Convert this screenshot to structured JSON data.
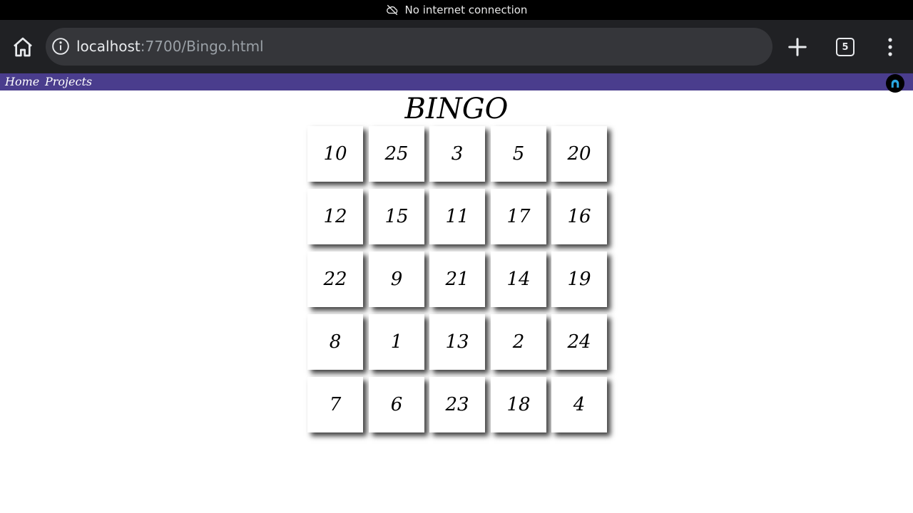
{
  "status": {
    "text": "No internet connection",
    "icon": "cloud-off-icon"
  },
  "browser": {
    "url_host": "localhost",
    "url_path": ":7700/Bingo.html",
    "tab_count": "5",
    "icons": [
      "home-icon",
      "info-icon",
      "plus-icon",
      "tabs-icon",
      "more-vert-icon"
    ]
  },
  "nav": {
    "home_label": "Home",
    "projects_label": "Projects",
    "bar_color": "#4a3d8d",
    "avatar_icon": "github-icon"
  },
  "page": {
    "title": "BINGO"
  },
  "board": {
    "rows": [
      [
        "10",
        "25",
        "3",
        "5",
        "20"
      ],
      [
        "12",
        "15",
        "11",
        "17",
        "16"
      ],
      [
        "22",
        "9",
        "21",
        "14",
        "19"
      ],
      [
        "8",
        "1",
        "13",
        "2",
        "24"
      ],
      [
        "7",
        "6",
        "23",
        "18",
        "4"
      ]
    ]
  }
}
